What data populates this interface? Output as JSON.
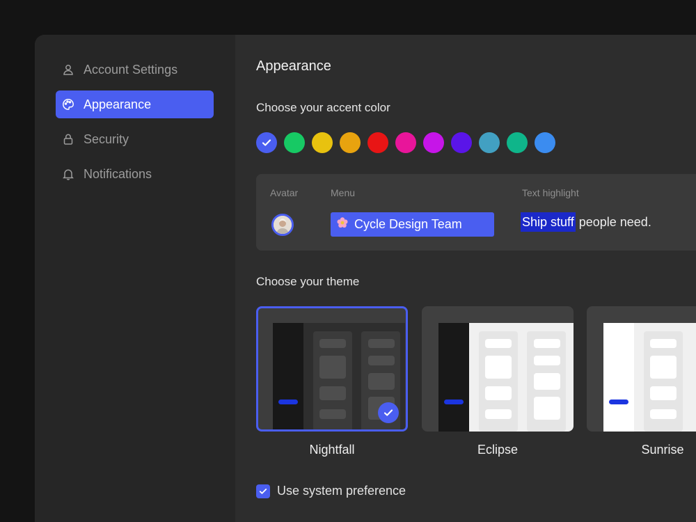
{
  "sidebar": {
    "items": [
      {
        "label": "Account Settings",
        "icon": "user-icon",
        "active": false
      },
      {
        "label": "Appearance",
        "icon": "palette-icon",
        "active": true
      },
      {
        "label": "Security",
        "icon": "lock-icon",
        "active": false
      },
      {
        "label": "Notifications",
        "icon": "bell-icon",
        "active": false
      }
    ]
  },
  "main": {
    "title": "Appearance",
    "accent": {
      "heading": "Choose your accent color",
      "selected_index": 0,
      "colors": [
        "#4a5ef0",
        "#17c964",
        "#e8c20f",
        "#e8a30f",
        "#e81515",
        "#e8159a",
        "#c615e8",
        "#5a15e8",
        "#42a0c2",
        "#0fb58a",
        "#3b8cf0"
      ]
    },
    "preview": {
      "avatar_label": "Avatar",
      "menu_label": "Menu",
      "menu_item": "Cycle Design Team",
      "menu_item_icon": "flower-icon",
      "highlight_label": "Text highlight",
      "highlight_text": "Ship stuff",
      "highlight_rest": " people need."
    },
    "theme": {
      "heading": "Choose your theme",
      "options": [
        {
          "name": "Nightfall",
          "selected": true
        },
        {
          "name": "Eclipse",
          "selected": false
        },
        {
          "name": "Sunrise",
          "selected": false
        }
      ]
    },
    "system_pref": {
      "label": "Use system preference",
      "checked": true
    }
  },
  "colors": {
    "accent": "#4a5ef0",
    "highlight": "#1b29c9",
    "window_bg": "#2d2d2d",
    "sidebar_bg": "#262626"
  }
}
